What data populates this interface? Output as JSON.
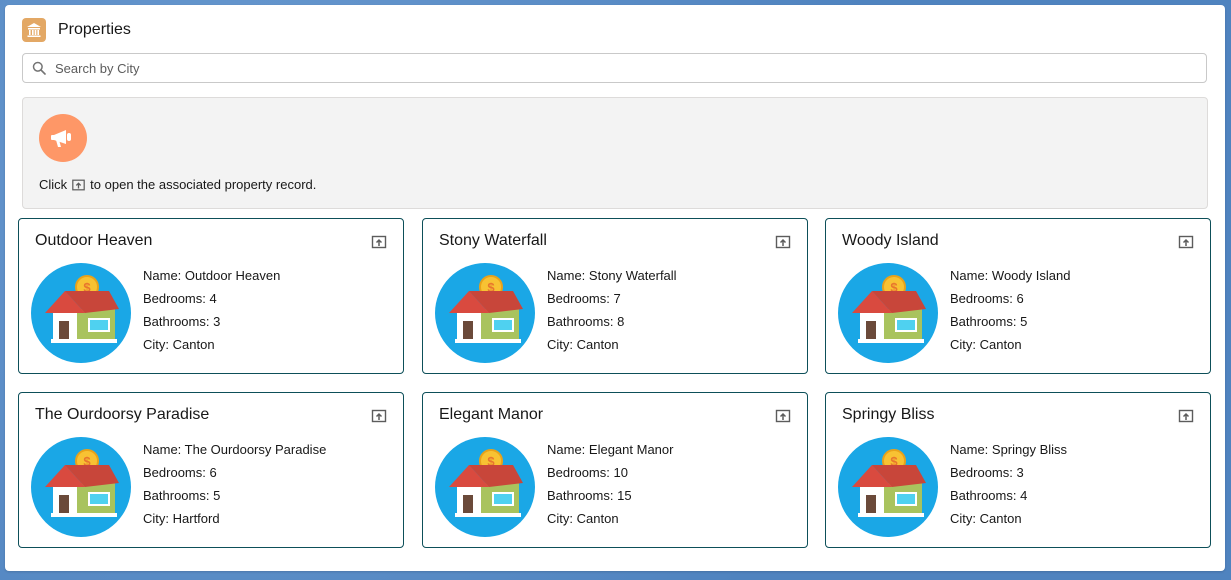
{
  "header": {
    "title": "Properties",
    "icon": "bank-icon"
  },
  "search": {
    "placeholder": "Search by City",
    "value": ""
  },
  "notice": {
    "prefix": "Click",
    "suffix": "to open the associated property record.",
    "icon": "megaphone-icon"
  },
  "labels": {
    "name": "Name: ",
    "bedrooms": "Bedrooms: ",
    "bathrooms": "Bathrooms: ",
    "city": "City: "
  },
  "properties": [
    {
      "title": "Outdoor Heaven",
      "name": "Outdoor Heaven",
      "bedrooms": "4",
      "bathrooms": "3",
      "city": "Canton"
    },
    {
      "title": "Stony Waterfall",
      "name": "Stony Waterfall",
      "bedrooms": "7",
      "bathrooms": "8",
      "city": "Canton"
    },
    {
      "title": "Woody Island",
      "name": "Woody Island",
      "bedrooms": "6",
      "bathrooms": "5",
      "city": "Canton"
    },
    {
      "title": "The Ourdoorsy Paradise",
      "name": "The Ourdoorsy Paradise",
      "bedrooms": "6",
      "bathrooms": "5",
      "city": "Hartford"
    },
    {
      "title": "Elegant Manor",
      "name": "Elegant Manor",
      "bedrooms": "10",
      "bathrooms": "15",
      "city": "Canton"
    },
    {
      "title": "Springy Bliss",
      "name": "Springy Bliss",
      "bedrooms": "3",
      "bathrooms": "4",
      "city": "Canton"
    }
  ],
  "colors": {
    "tile_border": "#0d4f59",
    "house_circle": "#1aa7e6",
    "notice_icon": "#fe9767",
    "app_icon": "#e3a865"
  }
}
